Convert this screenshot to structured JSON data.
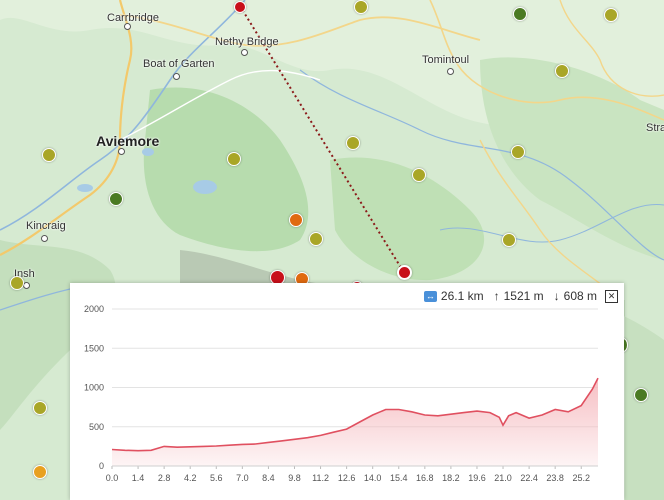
{
  "map": {
    "places": [
      {
        "key": "carrbridge",
        "name": "Carrbridge",
        "big": false
      },
      {
        "key": "nethy_bridge",
        "name": "Nethy Bridge",
        "big": false
      },
      {
        "key": "boat_of_garten",
        "name": "Boat of Garten",
        "big": false
      },
      {
        "key": "tomintoul",
        "name": "Tomintoul",
        "big": false
      },
      {
        "key": "aviemore",
        "name": "Aviemore",
        "big": true
      },
      {
        "key": "kincraig",
        "name": "Kincraig",
        "big": false
      },
      {
        "key": "insh",
        "name": "Insh",
        "big": false
      },
      {
        "key": "stra",
        "name": "Stra",
        "big": false
      }
    ],
    "colors": {
      "route": "#8b1a1a",
      "marker_olive": "#a9a627",
      "marker_green": "#4a7a22",
      "marker_orange": "#e06a10",
      "marker_red": "#c8101a",
      "marker_yellow_orange": "#e8a020"
    }
  },
  "profile": {
    "distance": "26.1 km",
    "ascent": "1521 m",
    "descent": "608 m",
    "close_icon": "close-icon",
    "up_arrow": "↑",
    "down_arrow": "↓"
  },
  "chart_data": {
    "type": "area",
    "ylim": [
      0,
      2000
    ],
    "yticks": [
      0,
      500,
      1000,
      1500,
      2000
    ],
    "xticks": [
      "0.0",
      "1.4",
      "2.8",
      "4.2",
      "5.6",
      "7.0",
      "8.4",
      "9.8",
      "11.2",
      "12.6",
      "14.0",
      "15.4",
      "16.8",
      "18.2",
      "19.6",
      "21.0",
      "22.4",
      "23.8",
      "25.2"
    ],
    "x": [
      0,
      0.7,
      1.4,
      2.1,
      2.8,
      3.5,
      4.2,
      4.9,
      5.6,
      6.3,
      7.0,
      7.7,
      8.4,
      9.1,
      9.8,
      10.5,
      11.2,
      11.9,
      12.6,
      13.3,
      14.0,
      14.7,
      15.4,
      16.1,
      16.8,
      17.5,
      18.2,
      18.9,
      19.6,
      20.3,
      20.8,
      21.0,
      21.3,
      21.7,
      22.4,
      23.1,
      23.8,
      24.5,
      25.2,
      25.8,
      26.1
    ],
    "y": [
      210,
      200,
      195,
      200,
      250,
      240,
      245,
      250,
      255,
      265,
      275,
      280,
      300,
      320,
      340,
      360,
      390,
      430,
      470,
      560,
      650,
      720,
      720,
      690,
      650,
      640,
      660,
      680,
      700,
      680,
      620,
      520,
      640,
      680,
      610,
      650,
      720,
      690,
      770,
      980,
      1120
    ],
    "line_color": "#e05060",
    "fill_color": "#f5b8bd"
  }
}
